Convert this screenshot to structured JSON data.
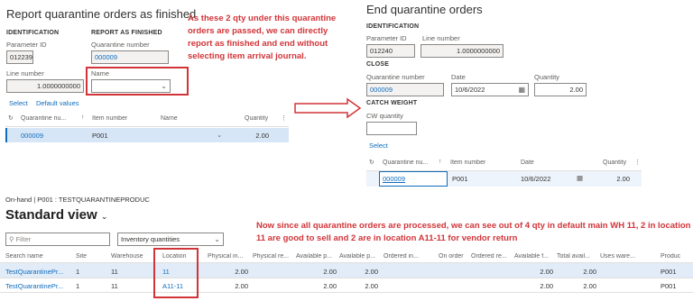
{
  "left": {
    "title": "Report quarantine orders as finished",
    "ident_header": "IDENTIFICATION",
    "report_header": "REPORT AS FINISHED",
    "param_label": "Parameter ID",
    "param_value": "012239",
    "qnum_label": "Quarantine number",
    "qnum_value": "000009",
    "line_label": "Line number",
    "line_value": "1.0000000000",
    "name_label": "Name",
    "select_label": "Select",
    "default_label": "Default values",
    "grid": {
      "headers": [
        "Quarantine nu...",
        "Item number",
        "Name",
        "Quantity"
      ],
      "row": [
        "000009",
        "P001",
        "",
        "2.00"
      ]
    }
  },
  "right": {
    "title": "End quarantine orders",
    "ident_header": "IDENTIFICATION",
    "param_label": "Parameter ID",
    "param_value": "012240",
    "line_label": "Line number",
    "line_value": "1.0000000000",
    "close_header": "CLOSE",
    "qnum_label": "Quarantine number",
    "qnum_value": "000009",
    "date_label": "Date",
    "date_value": "10/6/2022",
    "qty_label": "Quantity",
    "qty_value": "2.00",
    "cw_header": "CATCH WEIGHT",
    "cw_label": "CW quantity",
    "select_label": "Select",
    "grid": {
      "headers": [
        "Quarantine nu...",
        "Item number",
        "Date",
        "Quantity"
      ],
      "row": [
        "000009",
        "P001",
        "10/6/2022",
        "2.00"
      ]
    }
  },
  "annotation1": "As these 2 qty under this quarantine orders are passed, we can directly report as finished and end without selecting item arrival journal.",
  "annotation2": "Now since all quarantine orders are processed, we can see out of 4 qty in default main WH 11, 2 in location 11 are good to sell and 2 are in location A11-11 for vendor return",
  "onhand": {
    "breadcrumb": "On-hand  |  P001 : TESTQUARANTINEPRODUC",
    "view": "Standard view",
    "filter_placeholder": "Filter",
    "dimension_value": "Inventory quantities",
    "headers": [
      "Search name",
      "Site",
      "Warehouse",
      "Location",
      "Physical in...",
      "Physical re...",
      "Available p...",
      "Available p...",
      "Ordered in...",
      "On order",
      "Ordered re...",
      "Available f...",
      "Total avail...",
      "Uses ware...",
      "Produc"
    ],
    "rows": [
      [
        "TestQuarantinePr...",
        "1",
        "11",
        "11",
        "2.00",
        "",
        "2.00",
        "2.00",
        "",
        "",
        "",
        "2.00",
        "2.00",
        "",
        "P001"
      ],
      [
        "TestQuarantinePr...",
        "1",
        "11",
        "A11-11",
        "2.00",
        "",
        "2.00",
        "2.00",
        "",
        "",
        "",
        "2.00",
        "2.00",
        "",
        "P001"
      ]
    ]
  }
}
